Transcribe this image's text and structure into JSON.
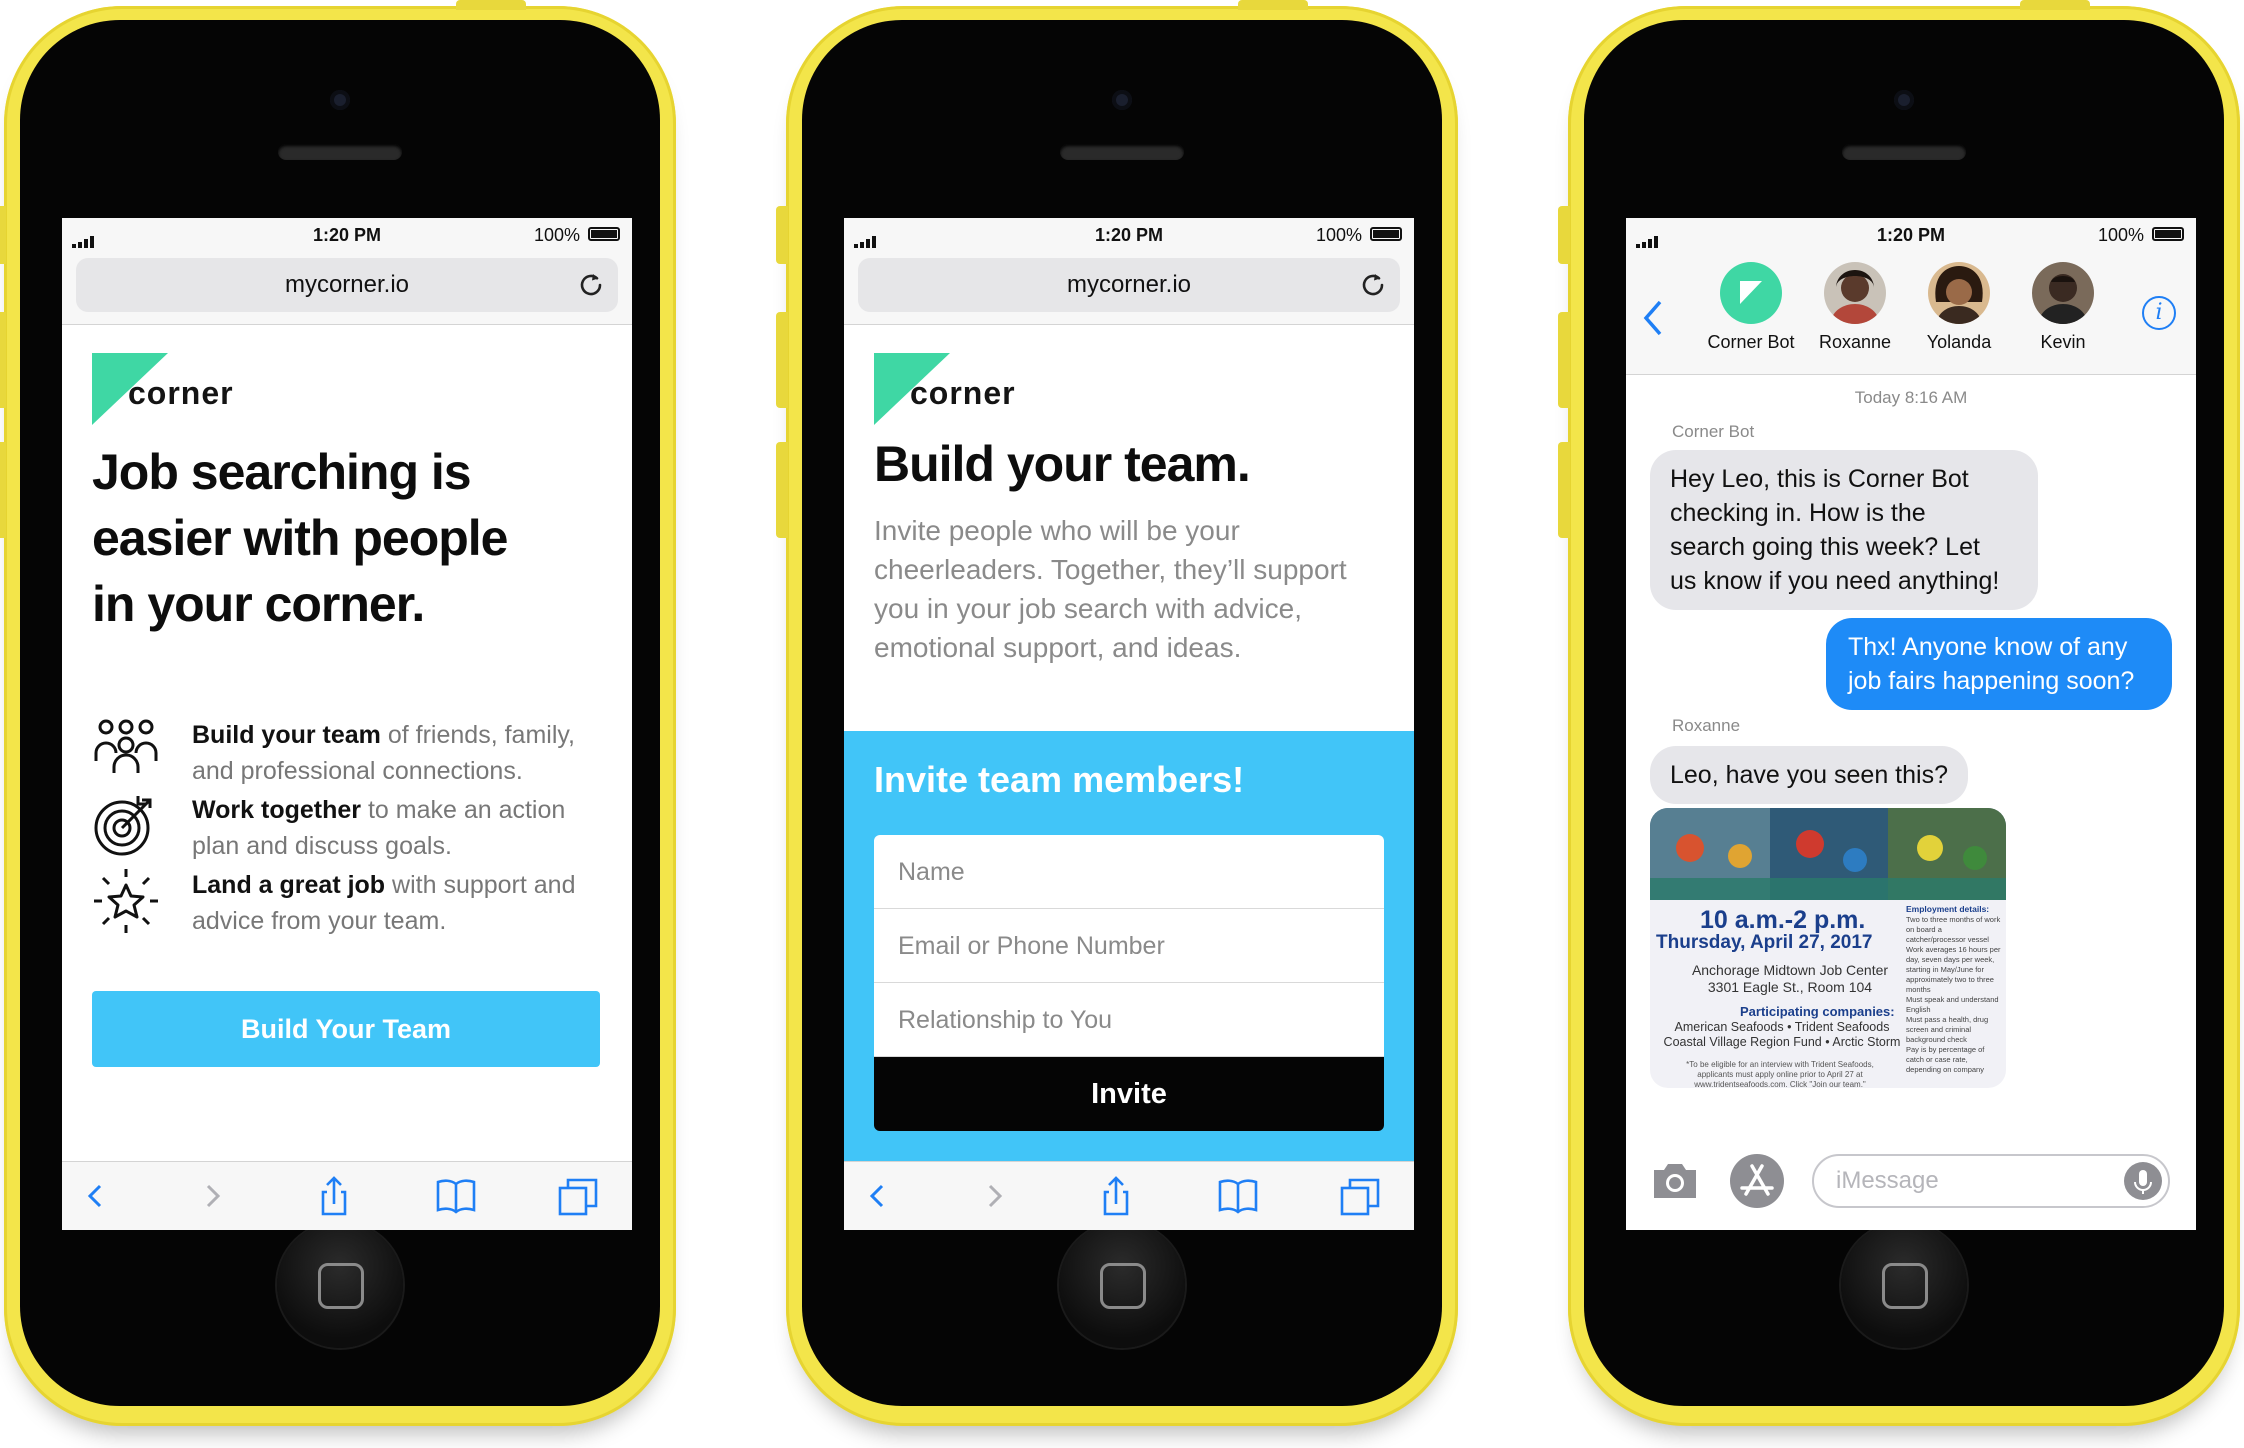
{
  "status": {
    "time": "1:20 PM",
    "battery": "100%"
  },
  "safari": {
    "url": "mycorner.io"
  },
  "brand": {
    "wordmark": "corner",
    "accent": "#3fd7a4",
    "blue": "#41c5f8"
  },
  "phone1": {
    "headline_1": "Job searching is",
    "headline_2": "easier with people",
    "headline_3": "in your corner.",
    "features": [
      {
        "icon": "people-icon",
        "bold": "Build your team",
        "rest_1": " of friends, family,",
        "rest_2": "and professional connections."
      },
      {
        "icon": "target-icon",
        "bold": "Work together",
        "rest_1": " to make an action",
        "rest_2": "plan and discuss goals."
      },
      {
        "icon": "star-icon",
        "bold": "Land a great job",
        "rest_1": " with support and",
        "rest_2": "advice from your team."
      }
    ],
    "cta": "Build Your Team"
  },
  "phone2": {
    "headline": "Build your team.",
    "sub_1": "Invite people who will be your",
    "sub_2": "cheerleaders. Together, they’ll support",
    "sub_3": "you in your job search with advice,",
    "sub_4": "emotional support, and ideas.",
    "panel_title": "Invite team members!",
    "fields": [
      "Name",
      "Email or Phone Number",
      "Relationship to You"
    ],
    "invite": "Invite"
  },
  "phone3": {
    "contacts": [
      {
        "name": "Corner Bot",
        "color": "#3fd7a4"
      },
      {
        "name": "Roxanne",
        "color": "#6b4a3a"
      },
      {
        "name": "Yolanda",
        "color": "#8a5a3a"
      },
      {
        "name": "Kevin",
        "color": "#3a2a22"
      }
    ],
    "timestamp": "Today 8:16 AM",
    "sender1": "Corner Bot",
    "msg1_1": "Hey Leo, this is Corner Bot",
    "msg1_2": "checking in. How is the",
    "msg1_3": "search going this week? Let",
    "msg1_4": "us know if you need anything!",
    "reply_1": "Thx! Anyone know of any",
    "reply_2": "job fairs happening soon?",
    "sender2": "Roxanne",
    "msg2": "Leo, have you seen this?",
    "flyer": {
      "time": "10 a.m.-2 p.m.",
      "date": "Thursday, April 27, 2017",
      "venue_1": "Anchorage Midtown Job Center",
      "venue_2": "3301 Eagle St., Room 104",
      "participating": "Participating  companies:",
      "companies_1": "American Seafoods • Trident Seafoods",
      "companies_2": "Coastal Village Region Fund • Arctic Storm",
      "fine_1": "*To be eligible for an interview with Trident Seafoods,",
      "fine_2": "applicants must apply online prior to April 27 at",
      "fine_3": "www.tridentseafoods.com. Click \"Join our team.\"",
      "side_title": "Employment details:",
      "side_items": [
        "Two to three months of work on board a catcher/processor vessel",
        "Work averages 16 hours per day, seven days per week, starting in May/June for approximately two to three months",
        "Must speak and understand English",
        "Must pass a health, drug screen and criminal background check",
        "Pay is by percentage of catch or case rate, depending on company"
      ]
    },
    "compose_placeholder": "iMessage"
  }
}
